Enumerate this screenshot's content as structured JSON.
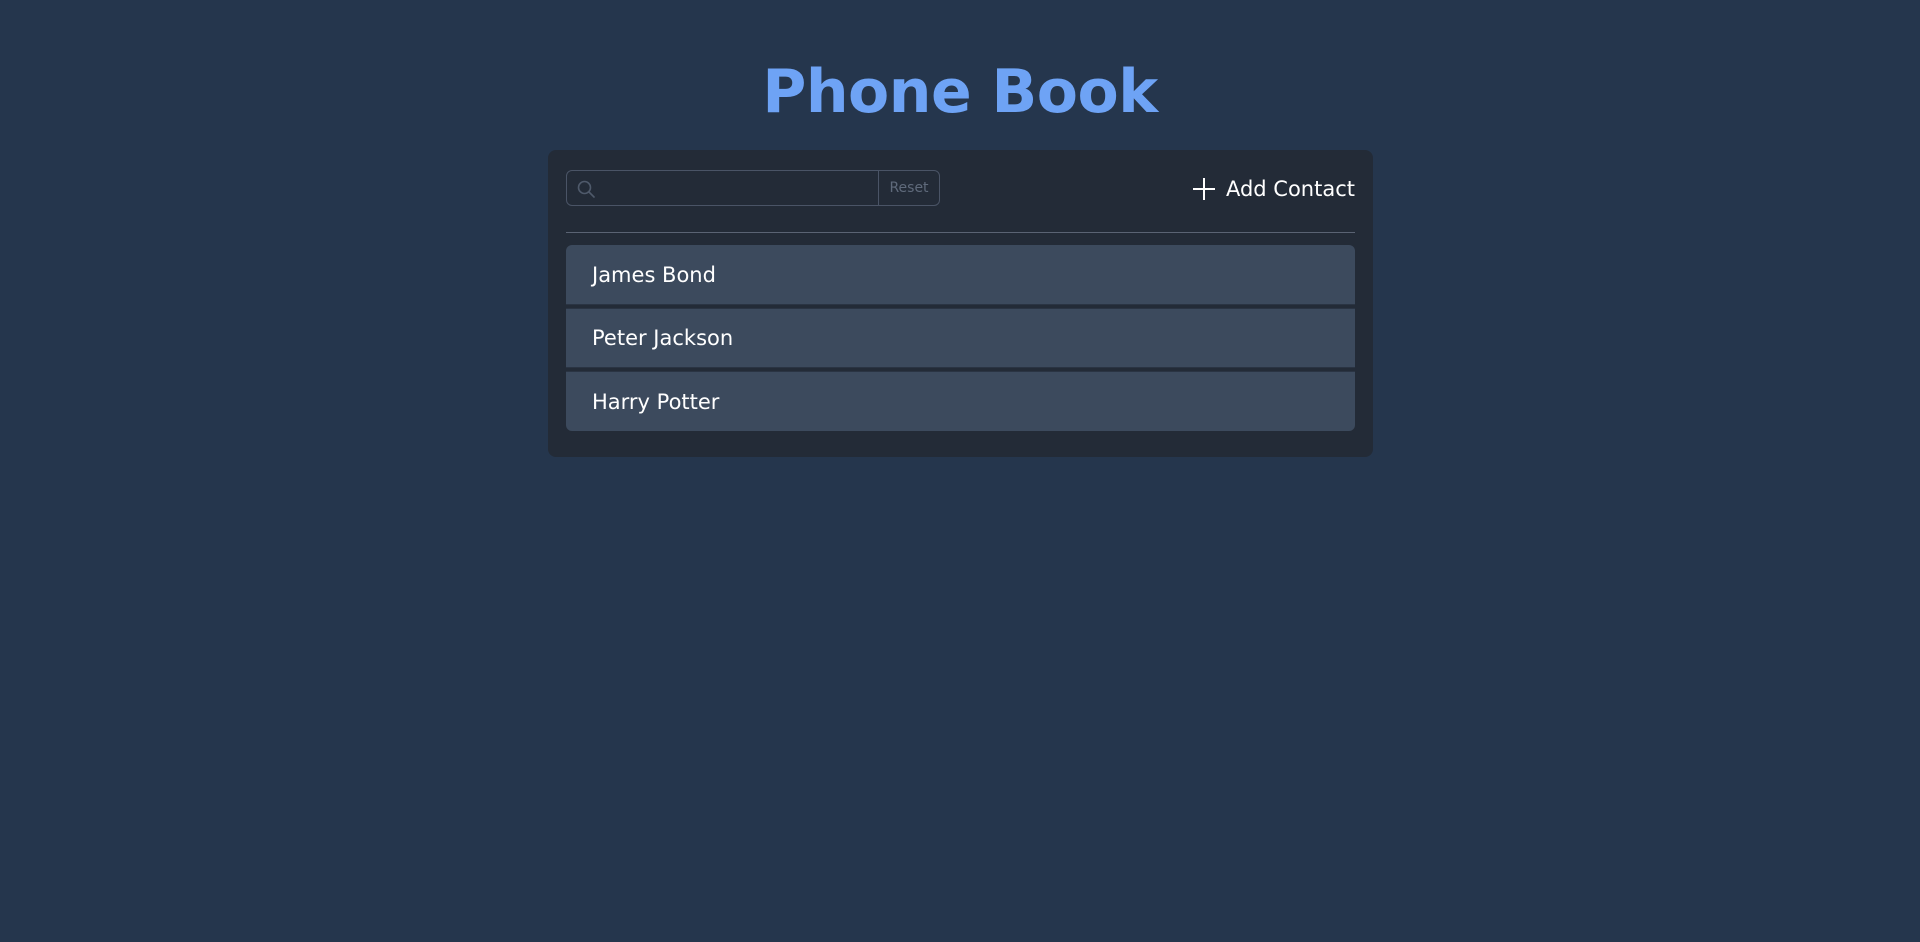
{
  "app": {
    "title": "Phone Book",
    "title_color": "#6ea3f5",
    "background_color": "#25364d"
  },
  "toolbar": {
    "search": {
      "icon": "search-icon",
      "value": "",
      "placeholder": ""
    },
    "reset_label": "Reset",
    "add_contact": {
      "icon": "plus-icon",
      "label": "Add Contact"
    }
  },
  "contacts": [
    {
      "name": "James Bond"
    },
    {
      "name": "Peter Jackson"
    },
    {
      "name": "Harry Potter"
    }
  ]
}
